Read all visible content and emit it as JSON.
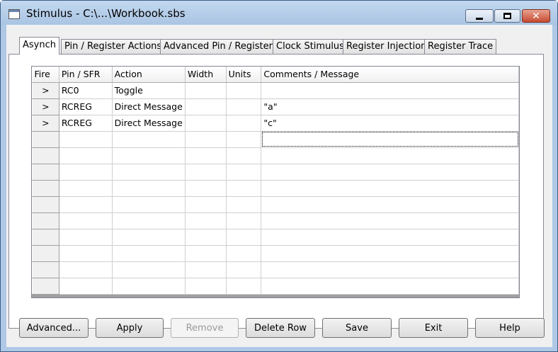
{
  "window": {
    "title": "Stimulus - C:\\...\\Workbook.sbs"
  },
  "tabs": [
    {
      "label": "Asynch",
      "active": true
    },
    {
      "label": "Pin / Register Actions",
      "active": false
    },
    {
      "label": "Advanced Pin / Register",
      "active": false
    },
    {
      "label": "Clock Stimulus",
      "active": false
    },
    {
      "label": "Register Injection",
      "active": false
    },
    {
      "label": "Register Trace",
      "active": false
    }
  ],
  "grid": {
    "columns": [
      "Fire",
      "Pin / SFR",
      "Action",
      "Width",
      "Units",
      "Comments / Message"
    ],
    "fire_glyph": ">",
    "rows": [
      {
        "fire": ">",
        "pin": "RC0",
        "action": "Toggle",
        "width": "",
        "units": "",
        "comment": ""
      },
      {
        "fire": ">",
        "pin": "RCREG",
        "action": "Direct Message",
        "width": "",
        "units": "",
        "comment": "\"a\""
      },
      {
        "fire": ">",
        "pin": "RCREG",
        "action": "Direct Message",
        "width": "",
        "units": "",
        "comment": "\"c\""
      }
    ],
    "empty_row_count": 10
  },
  "buttons": {
    "advanced": "Advanced...",
    "apply": "Apply",
    "remove": "Remove",
    "delete_row": "Delete Row",
    "save": "Save",
    "exit": "Exit",
    "help": "Help"
  },
  "colors": {
    "title_bar": "#aec8e6",
    "close_button": "#c74a32",
    "disabled_text": "#9a9a9a"
  }
}
